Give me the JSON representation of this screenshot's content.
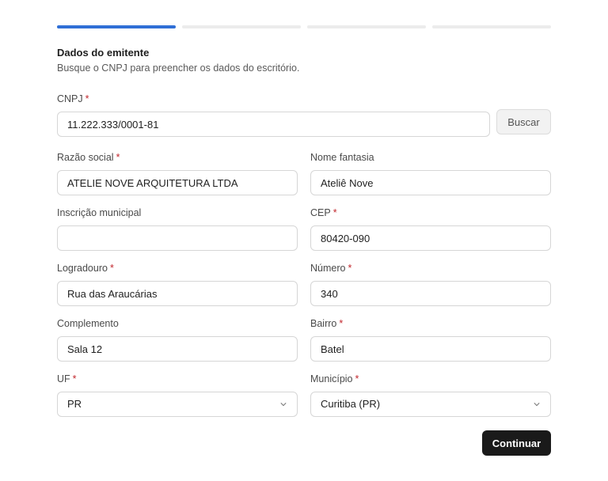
{
  "stepper": {
    "total_steps": 4,
    "current_step": 1
  },
  "section": {
    "title": "Dados do emitente",
    "subtitle": "Busque o CNPJ para preencher os dados do escritório."
  },
  "fields": {
    "cnpj": {
      "label": "CNPJ",
      "value": "11.222.333/0001-81"
    },
    "razao_social": {
      "label": "Razão social",
      "value": "ATELIE NOVE ARQUITETURA LTDA"
    },
    "nome_fantasia": {
      "label": "Nome fantasia",
      "value": "Ateliê Nove"
    },
    "inscricao_municipal": {
      "label": "Inscrição municipal",
      "value": ""
    },
    "cep": {
      "label": "CEP",
      "value": "80420-090"
    },
    "logradouro": {
      "label": "Logradouro",
      "value": "Rua das Araucárias"
    },
    "numero": {
      "label": "Número",
      "value": "340"
    },
    "complemento": {
      "label": "Complemento",
      "value": "Sala 12"
    },
    "bairro": {
      "label": "Bairro",
      "value": "Batel"
    },
    "uf": {
      "label": "UF",
      "value": "PR"
    },
    "municipio": {
      "label": "Município",
      "value": "Curitiba (PR)"
    }
  },
  "required_marker": "*",
  "buttons": {
    "buscar": "Buscar",
    "continuar": "Continuar"
  },
  "colors": {
    "accent": "#2f6fd6",
    "required": "#c2272d",
    "primary_button": "#1a1a1a"
  },
  "icons": {
    "select_chevron": "chevron-down-icon"
  }
}
